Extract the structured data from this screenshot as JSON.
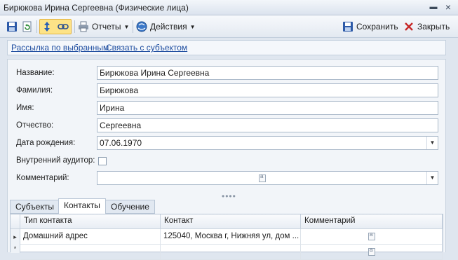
{
  "window": {
    "title": "Бирюкова Ирина Сергеевна (Физические лица)"
  },
  "toolbar": {
    "reports_label": "Отчеты",
    "actions_label": "Действия",
    "save_label": "Сохранить",
    "close_label": "Закрыть"
  },
  "links": {
    "mailing": "Рассылка по выбранным",
    "link_subject": "Связать с субъектом"
  },
  "form": {
    "name_label": "Название:",
    "name_value": "Бирюкова Ирина Сергеевна",
    "surname_label": "Фамилия:",
    "surname_value": "Бирюкова",
    "firstname_label": "Имя:",
    "firstname_value": "Ирина",
    "patronymic_label": "Отчество:",
    "patronymic_value": "Сергеевна",
    "birthdate_label": "Дата рождения:",
    "birthdate_value": "07.06.1970",
    "auditor_label": "Внутренний аудитор:",
    "auditor_checked": false,
    "comment_label": "Комментарий:",
    "comment_value": ""
  },
  "tabs": [
    {
      "label": "Субъекты",
      "active": false
    },
    {
      "label": "Контакты",
      "active": true
    },
    {
      "label": "Обучение",
      "active": false
    }
  ],
  "grid": {
    "columns": [
      "Тип контакта",
      "Контакт",
      "Комментарий"
    ],
    "rows": [
      {
        "indicator": "▸",
        "type": "Домашний адрес",
        "contact": "125040, Москва г, Нижняя ул, дом ..."
      },
      {
        "indicator": "*",
        "type": "",
        "contact": ""
      }
    ]
  }
}
